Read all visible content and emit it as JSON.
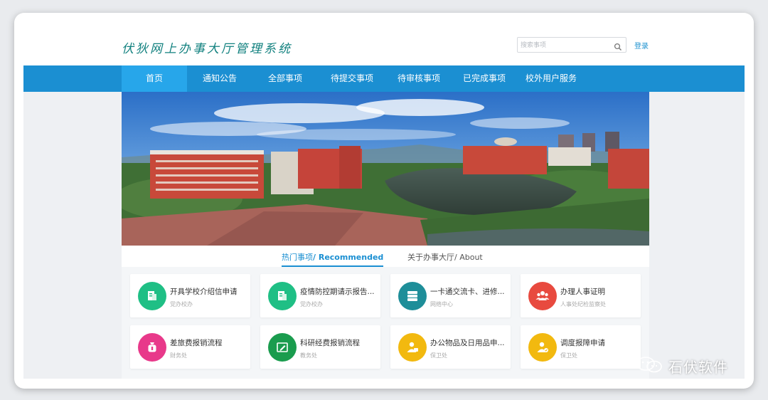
{
  "header": {
    "site_title": "伏狄网上办事大厅管理系统",
    "search_placeholder": "搜索事项",
    "login_label": "登录"
  },
  "nav": [
    {
      "label": "首页",
      "active": true
    },
    {
      "label": "通知公告"
    },
    {
      "label": "全部事项"
    },
    {
      "label": "待提交事项"
    },
    {
      "label": "待审核事项"
    },
    {
      "label": "已完成事项"
    },
    {
      "label": "校外用户服务"
    }
  ],
  "tabs": {
    "recommended_cn": "热门事项",
    "recommended_en": "/ Recommended",
    "about": "关于办事大厅/ About"
  },
  "cards": [
    {
      "title": "开具学校介绍信申请",
      "dept": "党办校办",
      "color": "#1fbf85",
      "icon": "document-icon"
    },
    {
      "title": "疫情防控期请示报告...",
      "dept": "党办校办",
      "color": "#1fbf85",
      "icon": "document-icon"
    },
    {
      "title": "一卡通交流卡、进修...",
      "dept": "网络中心",
      "color": "#1e8e99",
      "icon": "server-icon"
    },
    {
      "title": "办理人事证明",
      "dept": "人事处纪检监察处",
      "color": "#e84a3f",
      "icon": "people-icon"
    },
    {
      "title": "差旅费报销流程",
      "dept": "财务处",
      "color": "#e8398a",
      "icon": "money-bag-icon"
    },
    {
      "title": "科研经费报销流程",
      "dept": "教务处",
      "color": "#1a9c4e",
      "icon": "pen-form-icon"
    },
    {
      "title": "办公物品及日用品申...",
      "dept": "保卫处",
      "color": "#f2b90f",
      "icon": "user-card-icon"
    },
    {
      "title": "调度报障申请",
      "dept": "保卫处",
      "color": "#f2b90f",
      "icon": "user-check-icon"
    }
  ],
  "watermark": {
    "text": "石伏软件",
    "icon": "wechat-icon"
  }
}
